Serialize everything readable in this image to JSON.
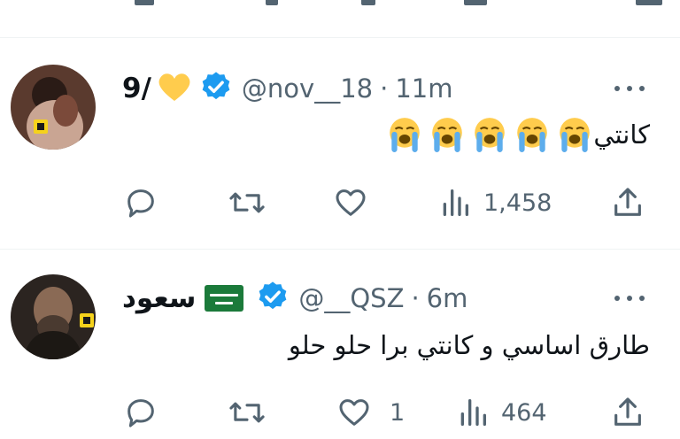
{
  "tweets": [
    {
      "name": "9/",
      "handle": "@nov__18",
      "time": "11m",
      "separator": "·",
      "text": "كانتي",
      "emoji_count": 5,
      "emoji_name": "loudly-crying-face-icon",
      "views": "1,458",
      "likes": "",
      "verified": true
    },
    {
      "name": "سعود",
      "handle": "@__QSZ",
      "time": "6m",
      "separator": "·",
      "text": "طارق اساسي و كانتي برا حلو حلو",
      "views": "464",
      "likes": "1",
      "verified": true
    }
  ],
  "colors": {
    "verified": "#1d9bf0",
    "muted": "#536471",
    "heart_emoji": "#ffcc4d",
    "flag": "#1b7a3a"
  }
}
